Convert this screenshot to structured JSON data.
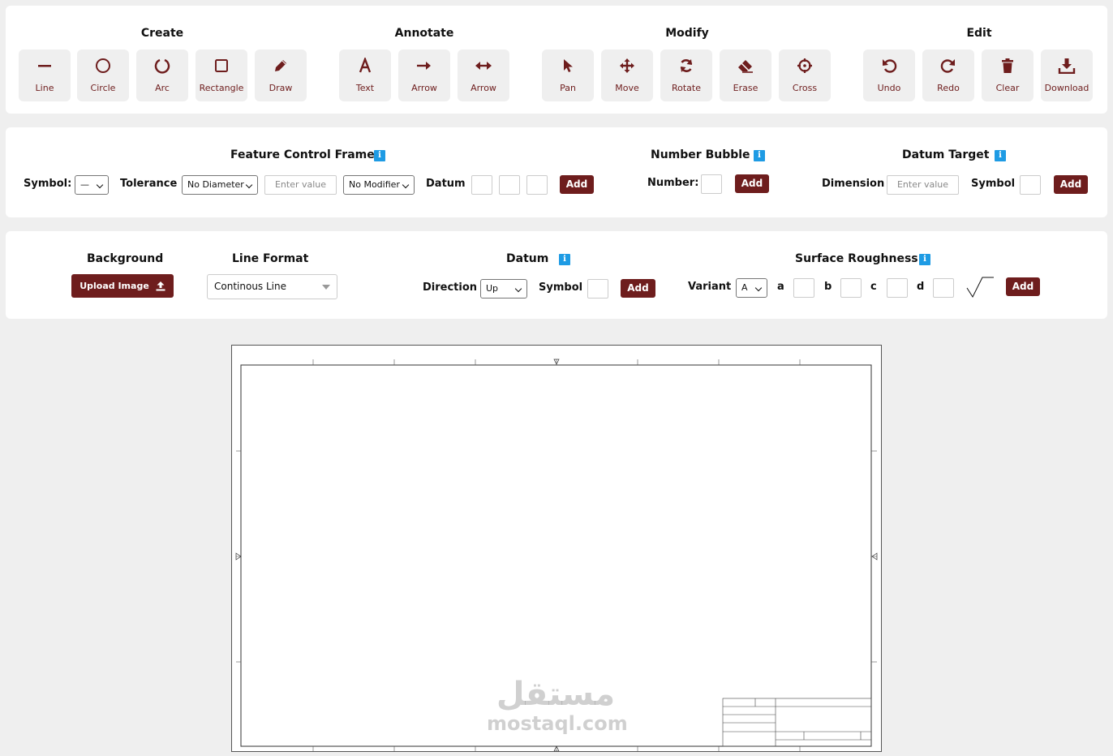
{
  "toolbar": {
    "groups": {
      "create": "Create",
      "annotate": "Annotate",
      "modify": "Modify",
      "edit": "Edit"
    },
    "tools": {
      "line": {
        "label": "Line",
        "icon": "line-icon"
      },
      "circle": {
        "label": "Circle",
        "icon": "circle-icon"
      },
      "arc": {
        "label": "Arc",
        "icon": "arc-icon"
      },
      "rectangle": {
        "label": "Rectangle",
        "icon": "rectangle-icon"
      },
      "draw": {
        "label": "Draw",
        "icon": "pencil-icon"
      },
      "text": {
        "label": "Text",
        "icon": "text-icon"
      },
      "arrow": {
        "label": "Arrow",
        "icon": "arrow-right-icon"
      },
      "double_arrow": {
        "label": "Arrow",
        "icon": "arrow-double-icon"
      },
      "pan": {
        "label": "Pan",
        "icon": "cursor-icon"
      },
      "move": {
        "label": "Move",
        "icon": "move-icon"
      },
      "rotate": {
        "label": "Rotate",
        "icon": "rotate-icon"
      },
      "erase": {
        "label": "Erase",
        "icon": "eraser-icon"
      },
      "cross": {
        "label": "Cross",
        "icon": "crosshair-icon"
      },
      "undo": {
        "label": "Undo",
        "icon": "undo-icon"
      },
      "redo": {
        "label": "Redo",
        "icon": "redo-icon"
      },
      "clear": {
        "label": "Clear",
        "icon": "trash-icon"
      },
      "download": {
        "label": "Download",
        "icon": "download-icon"
      }
    }
  },
  "fcf": {
    "title": "Feature Control Frame",
    "symbol_label": "Symbol:",
    "symbol_value": "—",
    "tolerance_label": "Tolerance",
    "diameter_value": "No Diameter",
    "value_placeholder": "Enter value",
    "modifier_value": "No Modifier",
    "datum_label": "Datum",
    "add": "Add"
  },
  "bubble": {
    "title": "Number Bubble",
    "number_label": "Number:",
    "add": "Add"
  },
  "datum_target": {
    "title": "Datum Target",
    "dimension_label": "Dimension",
    "value_placeholder": "Enter value",
    "symbol_label": "Symbol",
    "add": "Add"
  },
  "background": {
    "title": "Background",
    "upload": "Upload Image"
  },
  "line_format": {
    "title": "Line Format",
    "value": "Continous Line"
  },
  "datum": {
    "title": "Datum",
    "direction_label": "Direction",
    "direction_value": "Up",
    "symbol_label": "Symbol",
    "add": "Add"
  },
  "roughness": {
    "title": "Surface Roughness",
    "variant_label": "Variant",
    "variant_value": "A",
    "a": "a",
    "b": "b",
    "c": "c",
    "d": "d",
    "add": "Add"
  },
  "watermark": {
    "arabic": "مستقل",
    "latin": "mostaql.com"
  },
  "colors": {
    "accent": "#6e1d1d",
    "info": "#1e9be4",
    "page_bg": "#efefef"
  }
}
